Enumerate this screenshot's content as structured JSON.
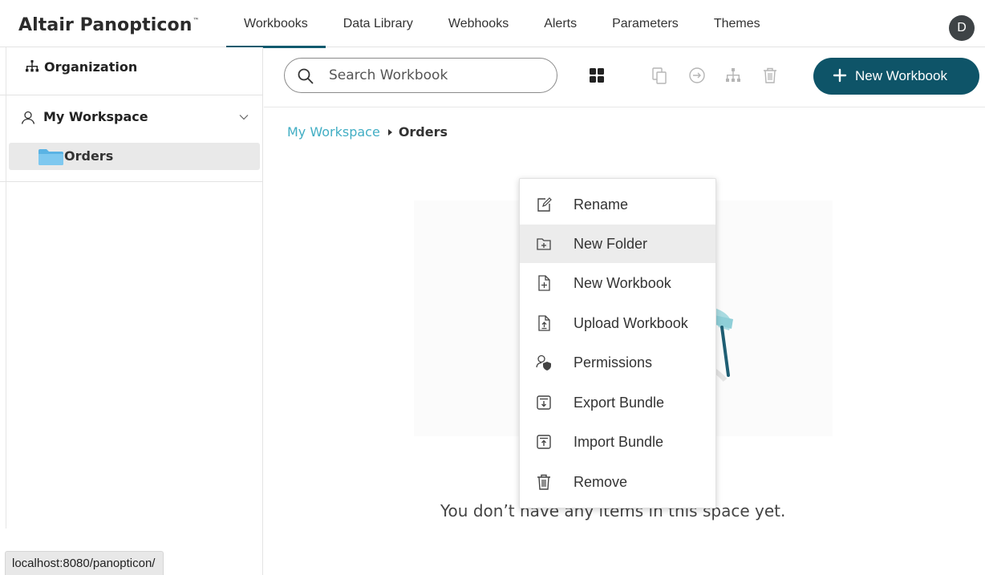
{
  "app": {
    "brand": "Altair Panopticon",
    "brand_tm": "™",
    "avatar_initial": "D",
    "accent_color": "#0e5468"
  },
  "nav": {
    "tabs": [
      {
        "label": "Workbooks",
        "active": true
      },
      {
        "label": "Data Library",
        "active": false
      },
      {
        "label": "Webhooks",
        "active": false
      },
      {
        "label": "Alerts",
        "active": false
      },
      {
        "label": "Parameters",
        "active": false
      },
      {
        "label": "Themes",
        "active": false
      }
    ]
  },
  "sidebar": {
    "organization_label": "Organization",
    "workspace_label": "My Workspace",
    "folders": [
      {
        "label": "Orders",
        "selected": true
      }
    ]
  },
  "toolbar": {
    "search_placeholder": "Search Workbook",
    "new_workbook_label": "New Workbook",
    "icons": [
      "grid-view-icon",
      "copy-icon",
      "move-icon",
      "hierarchy-icon",
      "trash-icon"
    ]
  },
  "breadcrumb": {
    "parent": "My Workspace",
    "current": "Orders"
  },
  "empty_state": {
    "message": "You don’t have any items in this space yet."
  },
  "context_menu": {
    "items": [
      {
        "label": "Rename",
        "icon": "rename-icon"
      },
      {
        "label": "New Folder",
        "icon": "new-folder-icon",
        "hover": true
      },
      {
        "label": "New Workbook",
        "icon": "new-workbook-icon"
      },
      {
        "label": "Upload Workbook",
        "icon": "upload-workbook-icon"
      },
      {
        "label": "Permissions",
        "icon": "permissions-icon"
      },
      {
        "label": "Export Bundle",
        "icon": "export-bundle-icon"
      },
      {
        "label": "Import Bundle",
        "icon": "import-bundle-icon"
      },
      {
        "label": "Remove",
        "icon": "remove-icon"
      }
    ]
  },
  "status": {
    "url": "localhost:8080/panopticon/"
  }
}
